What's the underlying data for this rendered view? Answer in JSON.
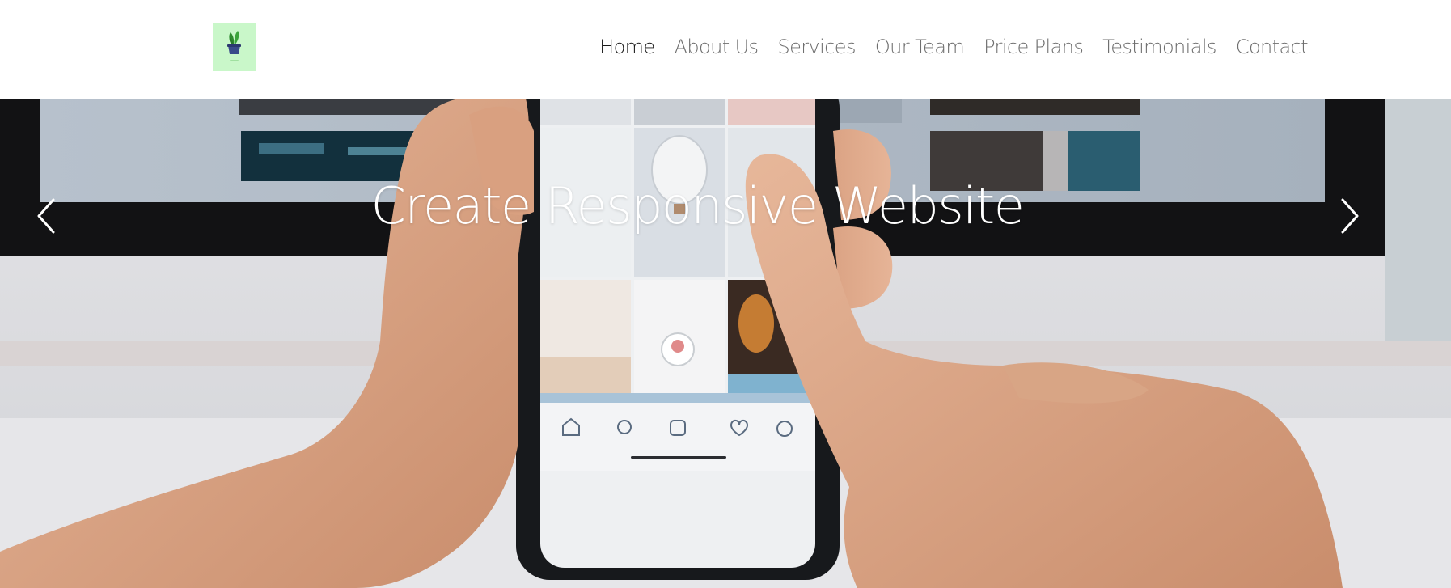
{
  "header": {
    "logo_icon": "plant-pot-icon",
    "nav": [
      {
        "label": "Home",
        "active": true
      },
      {
        "label": "About Us",
        "active": false
      },
      {
        "label": "Services",
        "active": false
      },
      {
        "label": "Our Team",
        "active": false
      },
      {
        "label": "Price Plans",
        "active": false
      },
      {
        "label": "Testimonials",
        "active": false
      },
      {
        "label": "Contact",
        "active": false
      }
    ]
  },
  "hero": {
    "title": "Create Responsive Website",
    "prev_icon": "chevron-left-icon",
    "next_icon": "chevron-right-icon"
  },
  "colors": {
    "logo_background": "#c9f7c9",
    "nav_text": "#6f6f6f",
    "nav_active_text": "#1a1a1a",
    "hero_title": "#ffffff"
  }
}
